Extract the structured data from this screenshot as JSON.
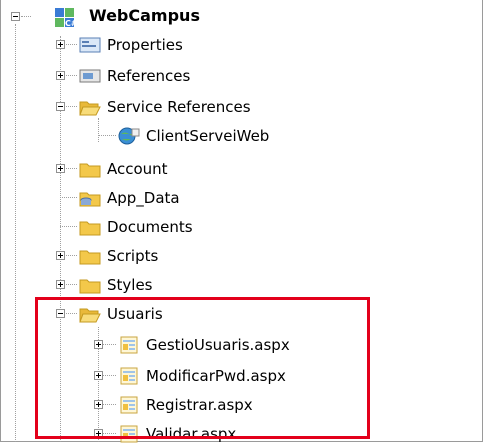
{
  "tree": {
    "root": {
      "label": "WebCampus",
      "icon": "csharp-project-icon",
      "state": "expanded"
    },
    "items": [
      {
        "label": "Properties",
        "icon": "properties-icon",
        "state": "collapsed"
      },
      {
        "label": "References",
        "icon": "references-icon",
        "state": "collapsed"
      },
      {
        "label": "Service References",
        "icon": "folder-open-icon",
        "state": "expanded"
      },
      {
        "label": "ClientServeiWeb",
        "icon": "web-service-icon",
        "state": "leaf"
      },
      {
        "label": "Account",
        "icon": "folder-icon",
        "state": "collapsed"
      },
      {
        "label": "App_Data",
        "icon": "folder-data-icon",
        "state": "leaf"
      },
      {
        "label": "Documents",
        "icon": "folder-icon",
        "state": "leaf"
      },
      {
        "label": "Scripts",
        "icon": "folder-icon",
        "state": "collapsed"
      },
      {
        "label": "Styles",
        "icon": "folder-icon",
        "state": "collapsed"
      },
      {
        "label": "Usuaris",
        "icon": "folder-open-icon",
        "state": "expanded"
      },
      {
        "label": "GestioUsuaris.aspx",
        "icon": "aspx-file-icon",
        "state": "collapsed"
      },
      {
        "label": "ModificarPwd.aspx",
        "icon": "aspx-file-icon",
        "state": "collapsed"
      },
      {
        "label": "Registrar.aspx",
        "icon": "aspx-file-icon",
        "state": "collapsed"
      },
      {
        "label": "Validar.aspx",
        "icon": "aspx-file-icon",
        "state": "collapsed"
      }
    ]
  },
  "colors": {
    "highlight": "#e3001b",
    "folder": "#f3c84a",
    "tree_lines": "#a0a0a0"
  }
}
